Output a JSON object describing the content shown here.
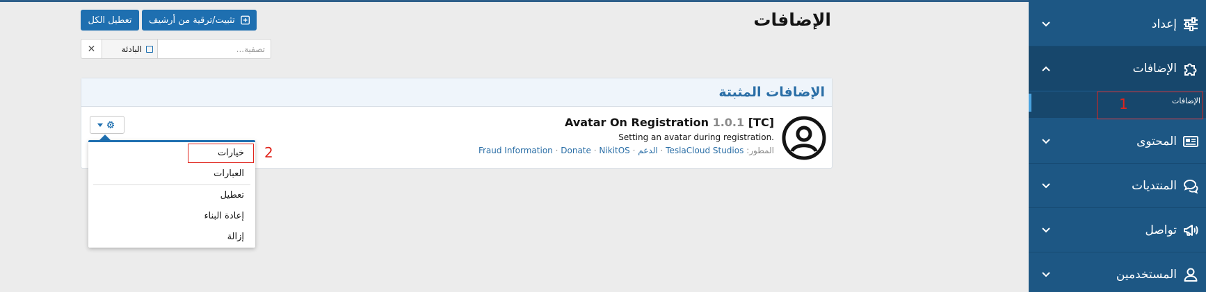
{
  "header": {
    "title": "الإضافات",
    "install_button": "تثبيت/ترقية من أرشيف",
    "disable_all_button": "تعطيل الكل"
  },
  "filter": {
    "placeholder": "تصفية...",
    "prefix_label": "البادئة",
    "clear_glyph": "✕"
  },
  "block": {
    "title": "الإضافات المثبتة"
  },
  "addon": {
    "name": "Avatar On Registration",
    "version": "1.0.1",
    "tag": "[TC]",
    "description": "Setting an avatar during registration.",
    "developer_label": "المطور:",
    "links": [
      "TeslaCloud Studios",
      "الدعم",
      "Fraud Information",
      "Donate",
      "NikitOS"
    ],
    "separator": "·"
  },
  "menu": {
    "items": [
      "خيارات",
      "العبارات",
      "تعطيل",
      "إعادة البناء",
      "إزالة"
    ]
  },
  "sidebar": {
    "sections": [
      {
        "label": "إعداد",
        "icon": "sliders-icon"
      },
      {
        "label": "الإضافات",
        "icon": "puzzle-icon"
      },
      {
        "label": "المحتوى",
        "icon": "newspaper-icon"
      },
      {
        "label": "المنتديات",
        "icon": "comments-icon"
      },
      {
        "label": "تواصل",
        "icon": "megaphone-icon"
      },
      {
        "label": "المستخدمين",
        "icon": "user-icon"
      }
    ],
    "sub_item": "الإضافات"
  },
  "annotations": {
    "marker_1": "1",
    "marker_2": "2"
  },
  "colors": {
    "sidebar_bg": "#1d5784",
    "primary_button": "#1e6fb0",
    "link": "#2a6ea6",
    "annotation_red": "#e0241c"
  }
}
